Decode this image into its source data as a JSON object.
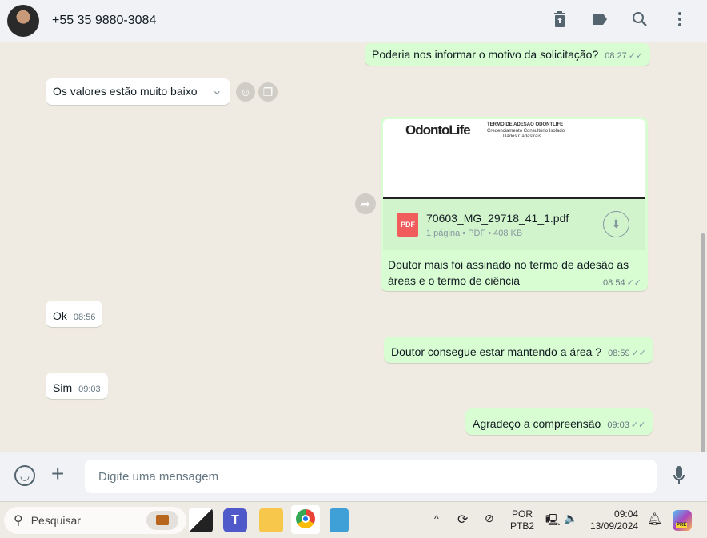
{
  "header": {
    "contact": "+55 35 9880-3084",
    "icons": [
      "delete-icon",
      "label-icon",
      "search-icon",
      "menu-icon"
    ]
  },
  "messages": [
    {
      "dir": "out",
      "text": "Poderia nos informar o motivo da solicitação?",
      "time": "08:27"
    },
    {
      "dir": "in",
      "text": "Os valores estão muito baixo"
    },
    {
      "dir": "out",
      "type": "document",
      "preview": {
        "logo": "OdontoLife",
        "title": "TERMO DE ADESAO ODONTLIFE",
        "subtitle": "Credenciamento Consultório Isolado",
        "section": "Dados Cadastrais"
      },
      "file_name": "70603_MG_29718_41_1.pdf",
      "file_meta": "1 página • PDF • 408 KB",
      "file_type": "PDF",
      "caption": "Doutor mais foi assinado no termo de adesão as áreas e o termo de ciência",
      "time": "08:54"
    },
    {
      "dir": "in",
      "text": "Ok",
      "time": "08:56"
    },
    {
      "dir": "out",
      "text": "Doutor consegue estar mantendo a área ?",
      "time": "08:59"
    },
    {
      "dir": "in",
      "text": "Sim",
      "time": "09:03"
    },
    {
      "dir": "out",
      "text": "Agradeço a compreensão",
      "time": "09:03"
    }
  ],
  "composer": {
    "placeholder": "Digite uma mensagem"
  },
  "taskbar": {
    "search": "Pesquisar",
    "lang1": "POR",
    "lang2": "PTB2",
    "time": "09:04",
    "date": "13/09/2024",
    "badge": "PRE"
  }
}
